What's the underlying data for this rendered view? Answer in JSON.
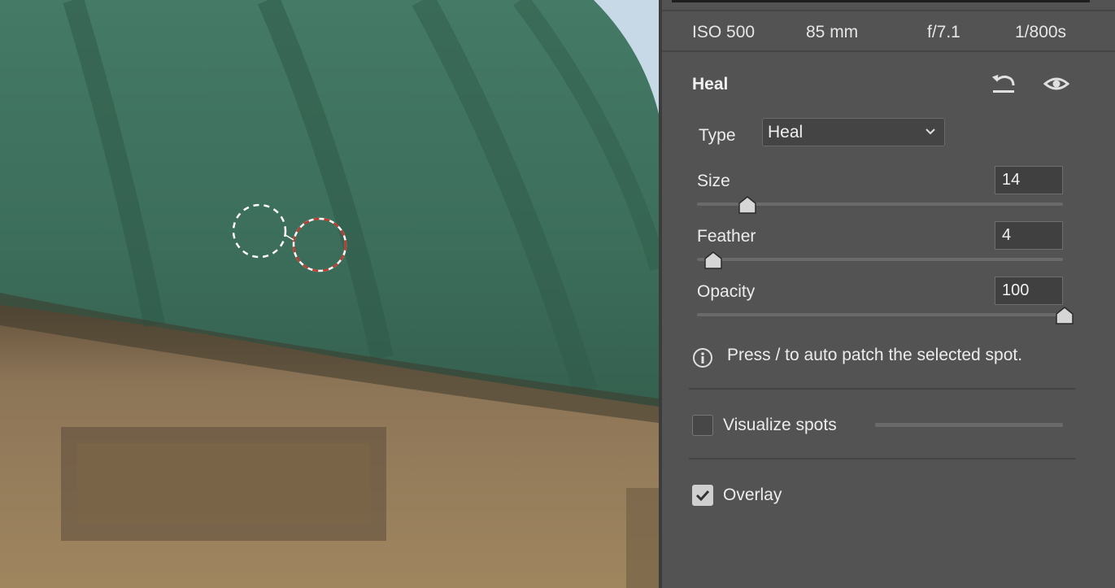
{
  "exif": {
    "iso": "ISO 500",
    "focal_length": "85 mm",
    "aperture": "f/7.1",
    "shutter": "1/800s"
  },
  "panel": {
    "title": "Heal",
    "reset_icon": "reset-icon",
    "visibility_icon": "eye-icon"
  },
  "type": {
    "label": "Type",
    "value": "Heal"
  },
  "sliders": {
    "size": {
      "label": "Size",
      "value": "14",
      "fraction": 0.13
    },
    "feather": {
      "label": "Feather",
      "value": "4",
      "fraction": 0.04
    },
    "opacity": {
      "label": "Opacity",
      "value": "100",
      "fraction": 1.0
    }
  },
  "hint": "Press / to auto patch the selected spot.",
  "visualize_spots": {
    "label": "Visualize spots",
    "checked": false
  },
  "overlay": {
    "label": "Overlay",
    "checked": true
  },
  "colors": {
    "panel_bg": "#535353",
    "source_circle": "#ffffff",
    "target_circle": "#c0392b"
  }
}
